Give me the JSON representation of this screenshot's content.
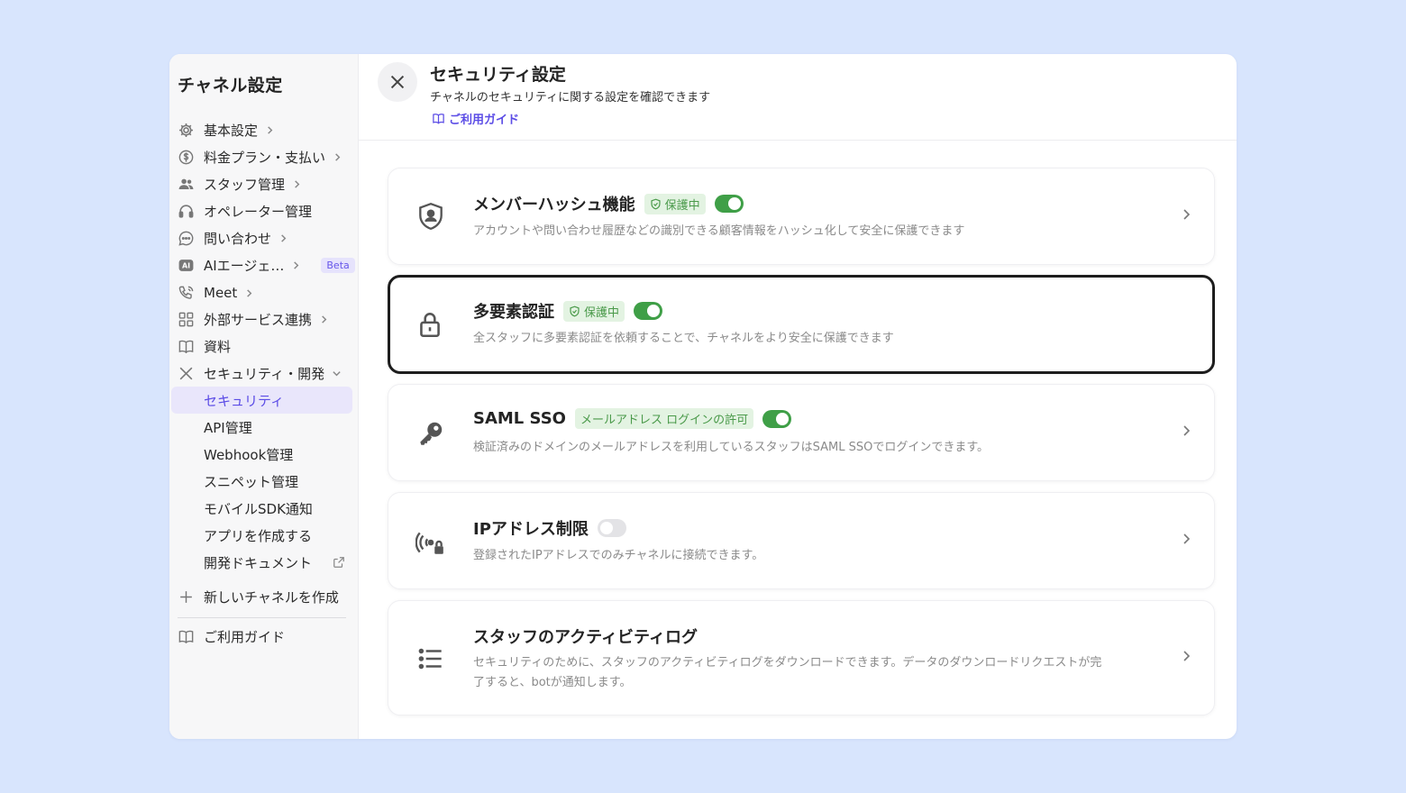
{
  "sidebar": {
    "title": "チャネル設定",
    "items": [
      {
        "label": "基本設定",
        "icon": "gear-icon"
      },
      {
        "label": "料金プラン・支払い",
        "icon": "dollar-circle-icon"
      },
      {
        "label": "スタッフ管理",
        "icon": "users-icon"
      },
      {
        "label": "オペレーター管理",
        "icon": "headset-icon"
      },
      {
        "label": "問い合わせ",
        "icon": "chat-bubble-icon"
      },
      {
        "label": "AIエージェ…",
        "icon": "ai-badge-icon",
        "badge": "Beta"
      },
      {
        "label": "Meet",
        "icon": "phone-icon"
      },
      {
        "label": "外部サービス連携",
        "icon": "grid-icon"
      },
      {
        "label": "資料",
        "icon": "book-icon"
      },
      {
        "label": "セキュリティ・開発",
        "icon": "tools-icon"
      }
    ],
    "subitems": [
      {
        "label": "セキュリティ",
        "active": true
      },
      {
        "label": "API管理"
      },
      {
        "label": "Webhook管理"
      },
      {
        "label": "スニペット管理"
      },
      {
        "label": "モバイルSDK通知"
      },
      {
        "label": "アプリを作成する"
      },
      {
        "label": "開発ドキュメント",
        "icon": "external-link-icon"
      }
    ],
    "new_channel": "新しいチャネルを作成",
    "guide": "ご利用ガイド"
  },
  "header": {
    "title": "セキュリティ設定",
    "subtitle": "チャネルのセキュリティに関する設定を確認できます",
    "guide_link": "ご利用ガイド"
  },
  "cards": [
    {
      "title": "メンバーハッシュ機能",
      "badge": "保護中",
      "toggle": "on",
      "icon": "shield-user-icon",
      "description": "アカウントや問い合わせ履歴などの識別できる顧客情報をハッシュ化して安全に保護できます"
    },
    {
      "title": "多要素認証",
      "badge": "保護中",
      "toggle": "on",
      "icon": "lock-icon",
      "selected": true,
      "description": "全スタッフに多要素認証を依頼することで、チャネルをより安全に保護できます"
    },
    {
      "title": "SAML SSO",
      "badge": "メールアドレス ログインの許可",
      "toggle": "on",
      "icon": "key-icon",
      "description": "検証済みのドメインのメールアドレスを利用しているスタッフはSAML SSOでログインできます。"
    },
    {
      "title": "IPアドレス制限",
      "toggle": "off",
      "icon": "broadcast-lock-icon",
      "description": "登録されたIPアドレスでのみチャネルに接続できます。"
    },
    {
      "title": "スタッフのアクティビティログ",
      "icon": "list-icon",
      "description_line1": "セキュリティのために、スタッフのアクティビティログをダウンロードできます。データのダウンロードリクエストが完",
      "description_line2": "了すると、botが通知します。"
    }
  ],
  "colors": {
    "accent": "#5b4ce6",
    "toggle_on": "#3f9f47",
    "badge_bg": "#e3f3e2",
    "badge_text": "#4a9a4a",
    "background": "#d8e5fd"
  }
}
